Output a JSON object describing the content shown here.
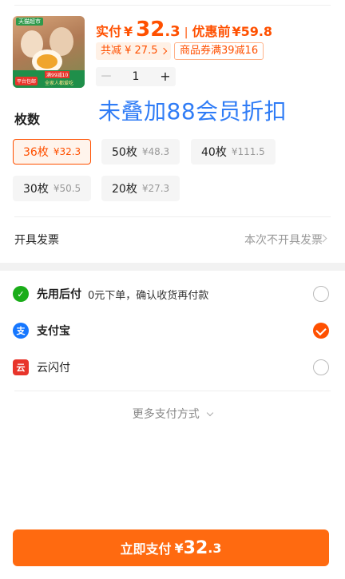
{
  "colors": {
    "accent": "#ff5000",
    "overlay_text": "#2f7cf6",
    "alipay": "#1677ff",
    "afterpay": "#1aad19",
    "unionpay": "#e8352b"
  },
  "product": {
    "image_icon": "egg-product-image",
    "thumb_tag": "天猫超市",
    "thumb_badge": "平台包邮",
    "thumb_promo1": "满99减10",
    "thumb_promo2": "全家人都爱吃",
    "price_label": "实付",
    "currency": "¥",
    "price_int": "32",
    "price_dec": ".3",
    "separator": "|",
    "original_label": "优惠前",
    "original_value": "¥59.8",
    "saving_text": "共减 ¥ 27.5",
    "coupon_text": "商品券满39减16",
    "quantity": "1",
    "minus": "－",
    "plus": "+"
  },
  "overlay_note": "未叠加88会员折扣",
  "spec": {
    "title": "枚数",
    "options": [
      {
        "label": "36枚",
        "price": "¥32.3",
        "selected": true
      },
      {
        "label": "50枚",
        "price": "¥48.3",
        "selected": false
      },
      {
        "label": "40枚",
        "price": "¥111.5",
        "selected": false
      },
      {
        "label": "30枚",
        "price": "¥50.5",
        "selected": false
      },
      {
        "label": "20枚",
        "price": "¥27.3",
        "selected": false
      }
    ]
  },
  "invoice": {
    "label": "开具发票",
    "value": "本次不开具发票"
  },
  "payment": {
    "methods": [
      {
        "icon": "afterpay-icon",
        "glyph": "✓",
        "name": "先用后付",
        "desc": "0元下单，确认收货再付款",
        "checked": false
      },
      {
        "icon": "alipay-icon",
        "glyph": "支",
        "name": "支付宝",
        "desc": "",
        "checked": true
      },
      {
        "icon": "unionpay-icon",
        "glyph": "云",
        "name": "云闪付",
        "desc": "",
        "checked": false
      }
    ],
    "more": "更多支付方式"
  },
  "submit": {
    "label": "立即支付",
    "currency": "¥",
    "int": "32",
    "dec": ".3"
  }
}
